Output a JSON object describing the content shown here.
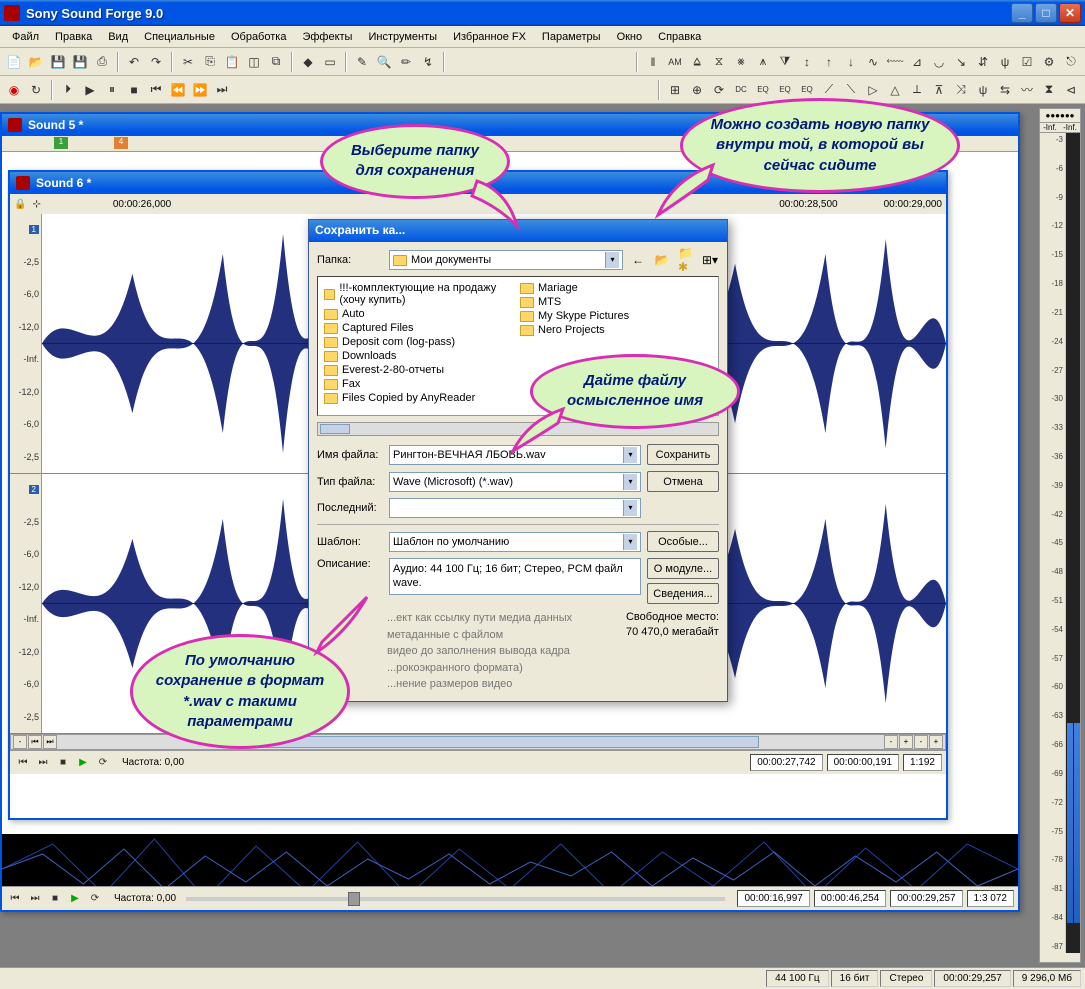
{
  "app": {
    "title": "Sony Sound Forge 9.0"
  },
  "menu": [
    "Файл",
    "Правка",
    "Вид",
    "Специальные",
    "Обработка",
    "Эффекты",
    "Инструменты",
    "Избранное FX",
    "Параметры",
    "Окно",
    "Справка"
  ],
  "subwin5": {
    "title": "Sound 5 *"
  },
  "subwin6": {
    "title": "Sound 6 *",
    "ruler": [
      "",
      "00:00:26,000",
      "",
      "",
      "",
      "",
      "",
      "00:00:28,500",
      "",
      "00:00:29,000"
    ],
    "db": [
      "-2,5",
      "-6,0",
      "-12,0",
      "-Inf.",
      "-12,0",
      "-6,0",
      "-2,5"
    ],
    "freq_label": "Частота: 0,00",
    "time1": "00:00:27,742",
    "time2": "00:00:00,191",
    "ratio": "1:192"
  },
  "outer_transport": {
    "freq_label": "Частота: 0,00",
    "time1": "00:00:16,997",
    "time2": "00:00:46,254",
    "time3": "00:00:29,257",
    "ratio": "1:3 072"
  },
  "dialog": {
    "title": "Сохранить ка...",
    "folder_label": "Папка:",
    "folder_value": "Мои документы",
    "files_left": [
      "!!!-комплектующие на продажу (хочу купить)",
      "Auto",
      "Captured Files",
      "Deposit com (log-pass)",
      "Downloads",
      "Everest-2-80-отчеты",
      "Fax",
      "Files Copied by AnyReader"
    ],
    "files_right": [
      "Mariage",
      "MTS",
      "My Skype Pictures",
      "Nero Projects"
    ],
    "name_label": "Имя файла:",
    "name_value": "Рингтон-ВЕЧНАЯ ЛБОВЬ.wav",
    "type_label": "Тип файла:",
    "type_value": "Wave (Microsoft) (*.wav)",
    "recent_label": "Последний:",
    "template_label": "Шаблон:",
    "template_value": "Шаблон по умолчанию",
    "desc_label": "Описание:",
    "desc_value": "Аудио: 44 100 Гц; 16 бит; Стерео, PCM файл wave.",
    "save_btn": "Сохранить",
    "cancel_btn": "Отмена",
    "custom_btn": "Особые...",
    "about_btn": "О модуле...",
    "prefs_btn": "Сведения...",
    "checks": [
      "...ект как ссылку пути медиа данных",
      "метаданные с файлом",
      "видео до заполнения вывода кадра",
      "...рокоэкранного формата)",
      "...нение размеров видео"
    ],
    "free_label": "Свободное место:",
    "free_value": "70 470,0 мегабайт"
  },
  "callouts": {
    "c1": "Выберите папку для сохранения",
    "c2": "Можно создать новую папку внутри той, в которой вы сейчас сидите",
    "c3": "Дайте файлу осмысленное имя",
    "c4": "По умолчанию сохранение в формат *.wav с такими параметрами"
  },
  "meters": {
    "tabs": "●●●●●●",
    "inf": "-Inf.",
    "vals": [
      "-3",
      "-6",
      "-9",
      "-12",
      "-15",
      "-18",
      "-21",
      "-24",
      "-27",
      "-30",
      "-33",
      "-36",
      "-39",
      "-42",
      "-45",
      "-48",
      "-51",
      "-54",
      "-57",
      "-60",
      "-63",
      "-66",
      "-69",
      "-72",
      "-75",
      "-78",
      "-81",
      "-84",
      "-87"
    ]
  },
  "status": {
    "rate": "44 100 Гц",
    "bits": "16 бит",
    "ch": "Стерео",
    "len": "00:00:29,257",
    "mem": "9 296,0 Мб"
  }
}
